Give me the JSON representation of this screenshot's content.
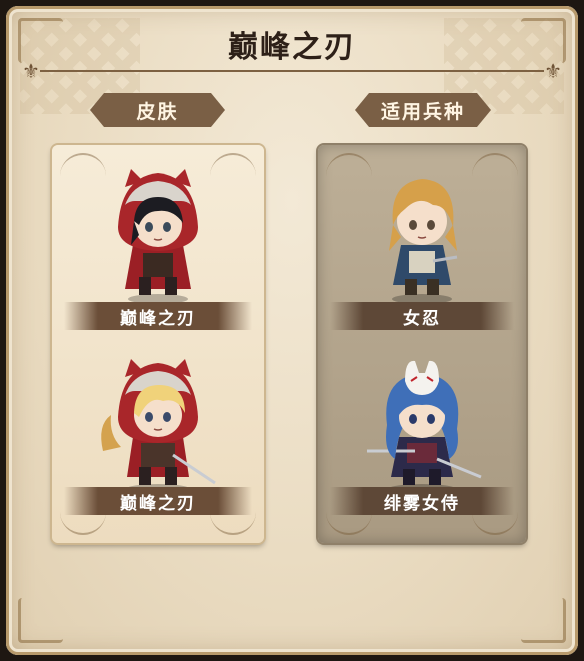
{
  "title": "巅峰之刃",
  "sections": {
    "skins_label": "皮肤",
    "units_label": "适用兵种"
  },
  "skins": [
    {
      "name": "巅峰之刃",
      "icon": "red-hood-black-hair-character-icon"
    },
    {
      "name": "巅峰之刃",
      "icon": "red-hood-blonde-hair-character-icon"
    }
  ],
  "units": [
    {
      "name": "女忍",
      "icon": "female-ninja-character-icon"
    },
    {
      "name": "绯雾女侍",
      "icon": "fox-mask-swordswoman-character-icon"
    }
  ],
  "colors": {
    "panel_bg": "#eadcc2",
    "ribbon": "#7a5f45",
    "unit_card_bg": "#b3a48c",
    "nameplate": "#6b4e38",
    "hood_red": "#a9262a"
  }
}
